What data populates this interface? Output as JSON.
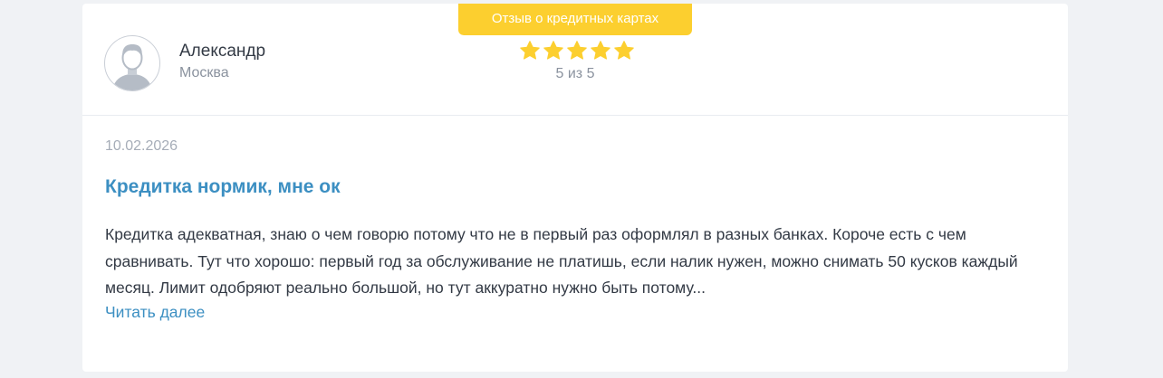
{
  "review": {
    "badge_label": "Отзыв о кредитных картах",
    "author": {
      "name": "Александр",
      "city": "Москва",
      "avatar_icon": "user-avatar-icon"
    },
    "rating": {
      "value": 5,
      "max": 5,
      "label": "5 из 5",
      "star_icon": "star-icon",
      "star_color": "#fccf2f"
    },
    "date": "10.02.2026",
    "title": "Кредитка нормик, мне ок",
    "text": "Кредитка адекватная, знаю о чем говорю потому что не в первый раз оформлял в разных банках. Короче есть с чем сравнивать. Тут что хорошо: первый год за обслуживание не платишь, если налик нужен, можно снимать 50 кусков каждый месяц. Лимит одобряют реально большой, но тут аккуратно нужно быть потому...",
    "read_more_label": "Читать далее",
    "colors": {
      "accent": "#3c8fc2",
      "badge": "#fccf2f",
      "page_background": "#f0f2f5"
    }
  }
}
